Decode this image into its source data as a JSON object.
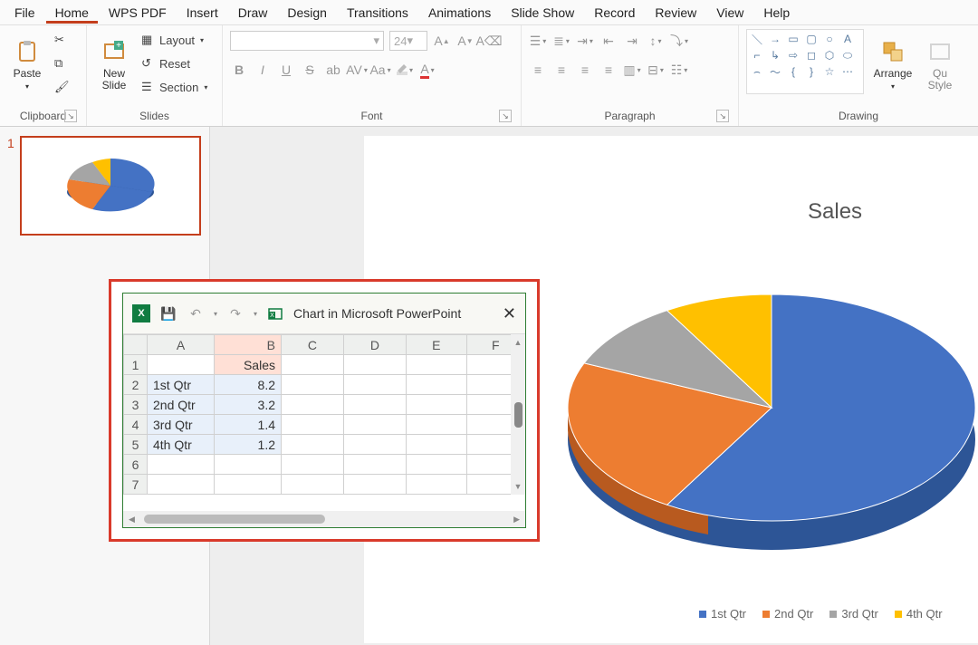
{
  "menu": [
    "File",
    "Home",
    "WPS PDF",
    "Insert",
    "Draw",
    "Design",
    "Transitions",
    "Animations",
    "Slide Show",
    "Record",
    "Review",
    "View",
    "Help"
  ],
  "active_menu_index": 1,
  "ribbon": {
    "clipboard": {
      "label": "Clipboard",
      "paste": "Paste"
    },
    "slides": {
      "label": "Slides",
      "new_slide": "New\nSlide",
      "layout": "Layout",
      "reset": "Reset",
      "section": "Section"
    },
    "font": {
      "label": "Font",
      "name_ph": "",
      "size_ph": "24"
    },
    "paragraph": {
      "label": "Paragraph"
    },
    "drawing": {
      "label": "Drawing",
      "arrange": "Arrange",
      "quick": "Qu\nStyle"
    }
  },
  "thumb": {
    "num": "1"
  },
  "chart_data": {
    "type": "pie",
    "title": "Sales",
    "categories": [
      "1st Qtr",
      "2nd Qtr",
      "3rd Qtr",
      "4th Qtr"
    ],
    "values": [
      8.2,
      3.2,
      1.4,
      1.2
    ],
    "colors": [
      "#4472c4",
      "#ed7d31",
      "#a5a5a5",
      "#ffc000"
    ],
    "legend_position": "bottom"
  },
  "excel": {
    "title": "Chart in Microsoft PowerPoint",
    "columns": [
      "A",
      "B",
      "C",
      "D",
      "E",
      "F"
    ],
    "header_row": {
      "B": "Sales"
    },
    "rows": [
      {
        "n": "2",
        "A": "1st Qtr",
        "B": "8.2"
      },
      {
        "n": "3",
        "A": "2nd Qtr",
        "B": "3.2"
      },
      {
        "n": "4",
        "A": "3rd Qtr",
        "B": "1.4"
      },
      {
        "n": "5",
        "A": "4th Qtr",
        "B": "1.2"
      },
      {
        "n": "6",
        "A": "",
        "B": ""
      },
      {
        "n": "7",
        "A": "",
        "B": ""
      }
    ]
  }
}
